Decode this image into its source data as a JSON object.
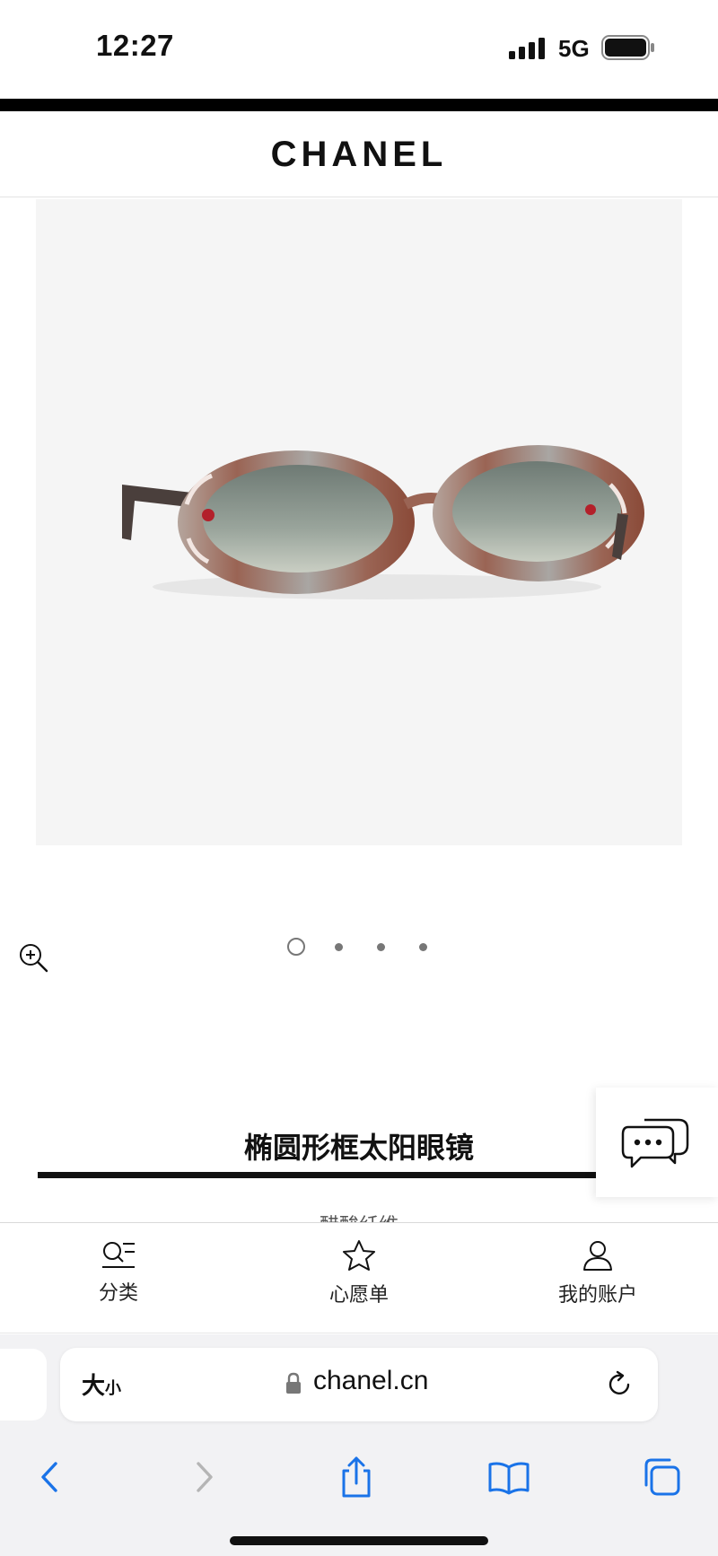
{
  "status_bar": {
    "time": "12:27",
    "network": "5G",
    "icons": [
      "signal-icon",
      "battery-icon"
    ]
  },
  "brand": {
    "logo_text": "CHANEL"
  },
  "product": {
    "title": "椭圆形框太阳眼镜",
    "subtitle_partial": "醋酸纤维",
    "carousel": {
      "total": 4,
      "active_index": 0
    }
  },
  "tab_bar": {
    "items": [
      {
        "label": "分类",
        "icon": "category-list-icon"
      },
      {
        "label": "心愿单",
        "icon": "star-icon"
      },
      {
        "label": "我的账户",
        "icon": "user-icon"
      }
    ]
  },
  "browser": {
    "text_size_big": "大",
    "text_size_small": "小",
    "url": "chanel.cn",
    "toolbar_icons": [
      "back-icon",
      "forward-icon",
      "share-icon",
      "bookmarks-icon",
      "tabs-icon"
    ]
  },
  "colors": {
    "accent_blue": "#1a73e8",
    "brand_black": "#111111",
    "image_background": "#f5f5f5"
  }
}
